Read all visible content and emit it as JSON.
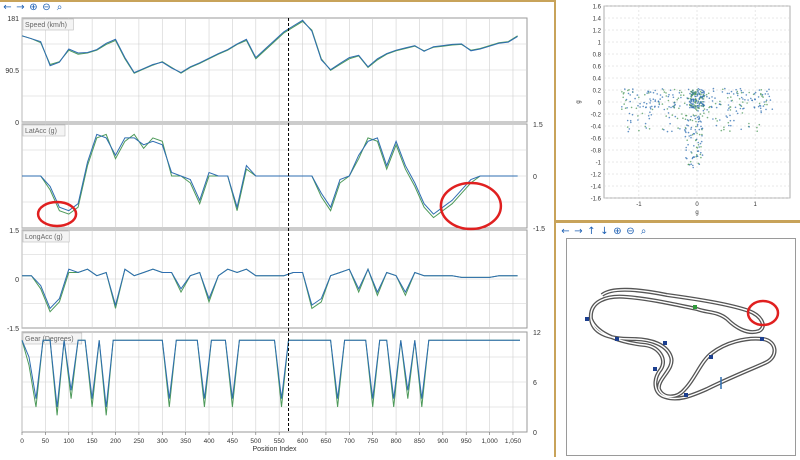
{
  "colors": {
    "series_primary": "#2e6db1",
    "series_secondary": "#4e9a5a",
    "annotation": "#e02020",
    "divider": "#c8a35a",
    "grid": "#cfcfcf",
    "cursor": "#000000"
  },
  "left_toolbar": {
    "icons": [
      "arrow-left-icon",
      "arrow-right-icon",
      "zoom-in-icon",
      "zoom-out-icon",
      "search-icon"
    ],
    "glyphs": [
      "←",
      "→",
      "⊕",
      "⊖",
      "⌕"
    ]
  },
  "right_toolbar": {
    "icons": [
      "arrow-left-icon",
      "arrow-right-icon",
      "arrow-up-icon",
      "arrow-down-icon",
      "zoom-in-icon",
      "zoom-out-icon",
      "search-icon"
    ],
    "glyphs": [
      "←",
      "→",
      "↑",
      "↓",
      "⊕",
      "⊖",
      "⌕"
    ]
  },
  "panels": {
    "speed": {
      "label": "Speed (km/h)",
      "y_ticks": [
        "181",
        "90.5",
        "0"
      ]
    },
    "latacc": {
      "label": "LatAcc (g)",
      "y_ticks": [
        "1.5",
        "0",
        "-1.5"
      ]
    },
    "longacc": {
      "label": "LongAcc (g)",
      "y_ticks": [
        "1.5",
        "0",
        "-1.5"
      ]
    },
    "gear": {
      "label": "Gear (Degrees)",
      "y_ticks": [
        "12",
        "6",
        "0"
      ]
    }
  },
  "x_axis": {
    "title": "Position Index",
    "ticks": [
      "0",
      "50",
      "100",
      "150",
      "200",
      "250",
      "300",
      "350",
      "400",
      "450",
      "500",
      "550",
      "600",
      "650",
      "700",
      "750",
      "800",
      "850",
      "900",
      "950",
      "1,000",
      "1,050"
    ]
  },
  "gg_plot": {
    "y_ticks": [
      "1.6",
      "1.4",
      "1.2",
      "1",
      "0.8",
      "0.6",
      "0.4",
      "0.2",
      "0",
      "-0.2",
      "-0.4",
      "-0.6",
      "-0.8",
      "-1",
      "-1.2",
      "-1.4",
      "-1.6"
    ],
    "x_ticks": [
      "-1",
      "0",
      "1"
    ],
    "xlabel": "g",
    "ylabel": "g"
  },
  "chart_data": [
    {
      "type": "line",
      "ylim": [
        0,
        181
      ],
      "x": [
        0,
        20,
        40,
        60,
        80,
        100,
        120,
        140,
        160,
        180,
        200,
        220,
        240,
        260,
        280,
        300,
        320,
        340,
        360,
        380,
        400,
        420,
        440,
        460,
        480,
        500,
        520,
        540,
        560,
        580,
        600,
        620,
        640,
        660,
        680,
        700,
        720,
        740,
        760,
        780,
        800,
        820,
        840,
        860,
        880,
        900,
        920,
        940,
        960,
        980,
        1000,
        1020,
        1040,
        1060
      ],
      "series": [
        {
          "values": [
            150,
            145,
            138,
            100,
            105,
            125,
            118,
            120,
            125,
            135,
            142,
            110,
            85,
            92,
            99,
            105,
            95,
            85,
            95,
            102,
            110,
            118,
            125,
            135,
            142,
            110,
            125,
            140,
            155,
            165,
            175,
            160,
            110,
            90,
            100,
            110,
            115,
            95,
            108,
            118,
            124,
            128,
            132,
            124,
            130,
            132,
            134,
            135,
            125,
            128,
            133,
            138,
            140,
            150
          ]
        },
        {
          "values": [
            150,
            145,
            140,
            98,
            104,
            127,
            120,
            121,
            126,
            137,
            144,
            112,
            86,
            93,
            100,
            104,
            94,
            86,
            96,
            103,
            111,
            119,
            126,
            136,
            144,
            112,
            127,
            142,
            157,
            167,
            177,
            158,
            108,
            91,
            102,
            112,
            116,
            96,
            110,
            119,
            125,
            129,
            133,
            123,
            131,
            133,
            135,
            136,
            124,
            127,
            132,
            137,
            139,
            149
          ]
        }
      ]
    },
    {
      "type": "line",
      "ylim": [
        -1.5,
        1.5
      ],
      "x": [
        0,
        20,
        40,
        60,
        80,
        100,
        120,
        140,
        160,
        180,
        200,
        220,
        240,
        260,
        280,
        300,
        320,
        340,
        360,
        380,
        400,
        420,
        440,
        460,
        480,
        500,
        520,
        540,
        560,
        580,
        600,
        620,
        640,
        660,
        680,
        700,
        720,
        740,
        760,
        780,
        800,
        820,
        840,
        860,
        880,
        900,
        920,
        940,
        960,
        980,
        1000,
        1020,
        1040,
        1060
      ],
      "series": [
        {
          "values": [
            0,
            0,
            0,
            -0.4,
            -1.0,
            -1.1,
            -0.9,
            0.3,
            1.1,
            1.2,
            0.5,
            1.0,
            1.2,
            0.8,
            1.1,
            1.0,
            0,
            0,
            -0.2,
            -0.8,
            0,
            0,
            0,
            -1.0,
            0.2,
            0,
            0,
            0,
            0,
            0,
            0,
            0,
            -0.6,
            -1.0,
            -0.2,
            0,
            0.5,
            1.1,
            1.0,
            0.2,
            0.9,
            0.2,
            -0.3,
            -0.9,
            -1.2,
            -1.0,
            -0.8,
            -0.5,
            -0.2,
            0,
            0,
            0,
            0,
            0
          ]
        },
        {
          "values": [
            0,
            0,
            0,
            -0.3,
            -0.9,
            -1.0,
            -0.8,
            0.4,
            1.2,
            1.1,
            0.6,
            1.1,
            1.1,
            0.9,
            1.0,
            0.9,
            0.1,
            0,
            -0.1,
            -0.7,
            0.1,
            0,
            0,
            -0.9,
            0.3,
            0,
            0,
            0,
            0,
            0,
            0,
            0,
            -0.5,
            -0.9,
            -0.1,
            0,
            0.6,
            1.0,
            1.1,
            0.3,
            1.0,
            0.3,
            -0.2,
            -0.8,
            -1.1,
            -0.9,
            -0.7,
            -0.4,
            -0.1,
            0,
            0,
            0,
            0,
            0
          ]
        }
      ]
    },
    {
      "type": "line",
      "ylim": [
        -1.5,
        1.5
      ],
      "x": [
        0,
        20,
        40,
        60,
        80,
        100,
        120,
        140,
        160,
        180,
        200,
        220,
        240,
        260,
        280,
        300,
        320,
        340,
        360,
        380,
        400,
        420,
        440,
        460,
        480,
        500,
        520,
        540,
        560,
        580,
        600,
        620,
        640,
        660,
        680,
        700,
        720,
        740,
        760,
        780,
        800,
        820,
        840,
        860,
        880,
        900,
        920,
        940,
        960,
        980,
        1000,
        1020,
        1040,
        1060
      ],
      "series": [
        {
          "values": [
            0.1,
            0.1,
            -0.3,
            -1.0,
            -0.7,
            0.2,
            0.2,
            0.3,
            0.1,
            0.2,
            -0.9,
            0.3,
            0.1,
            0.2,
            0.3,
            0.2,
            0.2,
            -0.4,
            0.1,
            0.2,
            -0.7,
            0.1,
            0.3,
            0.2,
            0.3,
            0.1,
            0.1,
            0.1,
            0.1,
            0.2,
            0.2,
            -0.9,
            -0.7,
            0.1,
            0.2,
            0.3,
            -0.4,
            0.3,
            -0.5,
            0.2,
            0.1,
            -0.5,
            0.2,
            0.1,
            0.1,
            0.1,
            0.1,
            0.05,
            0.05,
            0.05,
            0.05,
            0.1,
            0.1,
            0.1
          ]
        },
        {
          "values": [
            0.1,
            0.1,
            -0.2,
            -0.9,
            -0.6,
            0.3,
            0.2,
            0.3,
            0.1,
            0.2,
            -0.8,
            0.3,
            0.1,
            0.2,
            0.3,
            0.2,
            0.2,
            -0.3,
            0.1,
            0.2,
            -0.6,
            0.1,
            0.3,
            0.2,
            0.3,
            0.1,
            0.1,
            0.1,
            0.1,
            0.2,
            0.2,
            -0.8,
            -0.6,
            0.1,
            0.2,
            0.3,
            -0.3,
            0.3,
            -0.4,
            0.2,
            0.1,
            -0.4,
            0.2,
            0.1,
            0.1,
            0.1,
            0.1,
            0.05,
            0.05,
            0.05,
            0.05,
            0.1,
            0.1,
            0.1
          ]
        }
      ]
    },
    {
      "type": "line",
      "ylim": [
        0,
        12
      ],
      "x": [
        0,
        15,
        30,
        45,
        60,
        75,
        90,
        105,
        120,
        135,
        150,
        165,
        180,
        195,
        210,
        225,
        240,
        255,
        270,
        285,
        300,
        315,
        330,
        345,
        360,
        375,
        390,
        405,
        420,
        435,
        450,
        465,
        480,
        495,
        510,
        525,
        540,
        555,
        570,
        585,
        600,
        615,
        630,
        645,
        660,
        675,
        690,
        705,
        720,
        735,
        750,
        765,
        780,
        795,
        810,
        825,
        840,
        855,
        870,
        885,
        900,
        915,
        930,
        945,
        960,
        975,
        990,
        1005,
        1020,
        1035,
        1050,
        1065
      ],
      "series": [
        {
          "values": [
            11,
            8,
            3,
            11,
            11,
            2,
            11,
            4,
            11,
            11,
            3,
            11,
            2,
            11,
            11,
            11,
            11,
            11,
            11,
            11,
            11,
            3,
            11,
            11,
            11,
            11,
            3,
            11,
            11,
            11,
            3,
            11,
            11,
            11,
            11,
            11,
            11,
            3,
            11,
            11,
            11,
            11,
            11,
            11,
            11,
            3,
            11,
            11,
            11,
            11,
            3,
            11,
            11,
            3,
            11,
            4,
            11,
            3,
            11,
            11,
            11,
            11,
            11,
            11,
            11,
            11,
            11,
            11,
            11,
            11,
            11,
            11
          ]
        },
        {
          "values": [
            11,
            9,
            4,
            11,
            11,
            3,
            11,
            5,
            11,
            11,
            4,
            11,
            3,
            11,
            11,
            11,
            11,
            11,
            11,
            11,
            11,
            4,
            11,
            11,
            11,
            11,
            4,
            11,
            11,
            11,
            4,
            11,
            11,
            11,
            11,
            11,
            11,
            4,
            11,
            11,
            11,
            11,
            11,
            11,
            11,
            4,
            11,
            11,
            11,
            11,
            4,
            11,
            11,
            4,
            11,
            5,
            11,
            4,
            11,
            11,
            11,
            11,
            11,
            11,
            11,
            11,
            11,
            11,
            11,
            11,
            11,
            11
          ]
        }
      ]
    }
  ]
}
